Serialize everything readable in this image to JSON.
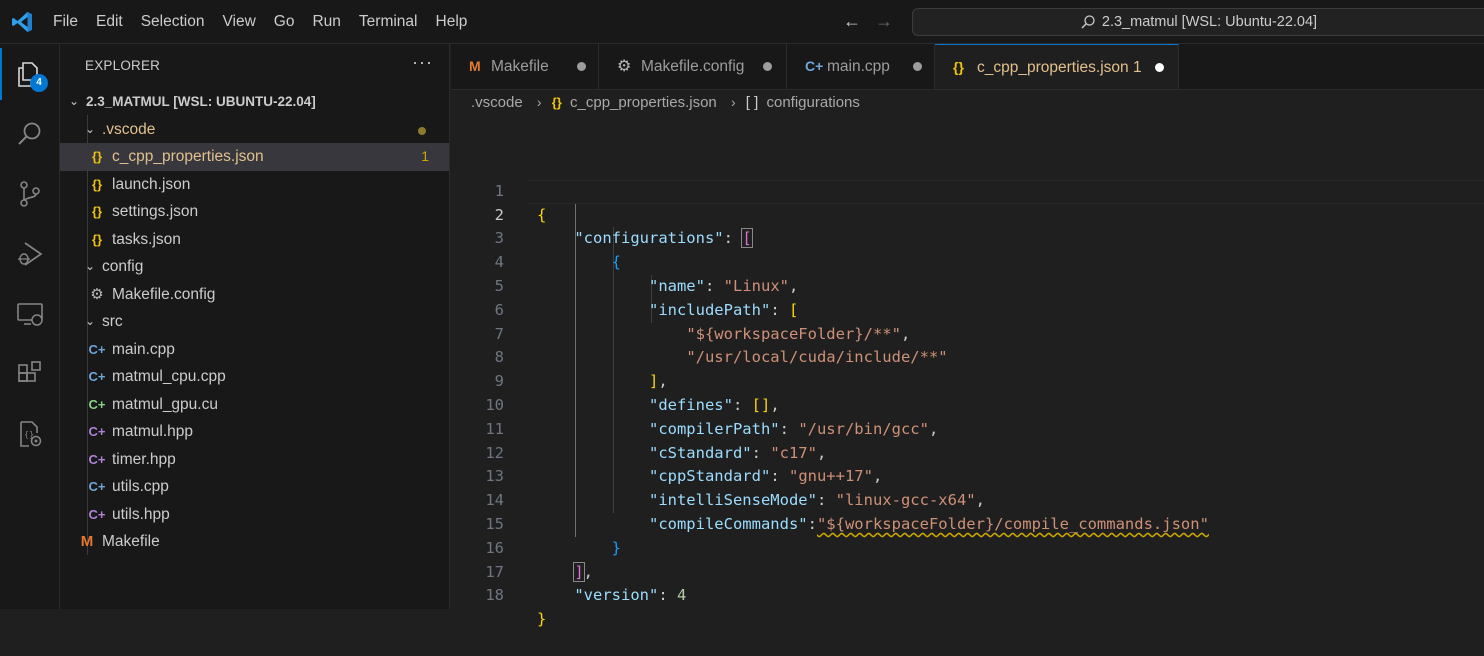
{
  "titlebar": {
    "menu": [
      "File",
      "Edit",
      "Selection",
      "View",
      "Go",
      "Run",
      "Terminal",
      "Help"
    ],
    "command_center": "2.3_matmul [WSL: Ubuntu-22.04]"
  },
  "activitybar": {
    "items": [
      "explorer-icon",
      "search-icon",
      "source-control-icon",
      "run-debug-icon",
      "remote-explorer-icon",
      "extensions-icon",
      "cmake-icon"
    ],
    "explorer_badge": "4"
  },
  "sidebar": {
    "header": "EXPLORER",
    "more": "···",
    "root": "2.3_MATMUL [WSL: UBUNTU-22.04]",
    "tree": [
      {
        "label": ".vscode",
        "type": "folder",
        "modified": true
      },
      {
        "label": "c_cpp_properties.json",
        "icon": "{}",
        "count": "1",
        "selected": true
      },
      {
        "label": "launch.json",
        "icon": "{}"
      },
      {
        "label": "settings.json",
        "icon": "{}"
      },
      {
        "label": "tasks.json",
        "icon": "{}"
      },
      {
        "label": "config",
        "type": "folder"
      },
      {
        "label": "Makefile.config",
        "icon": "gear-icon"
      },
      {
        "label": "src",
        "type": "folder"
      },
      {
        "label": "main.cpp",
        "icon": "C+"
      },
      {
        "label": "matmul_cpu.cpp",
        "icon": "C+"
      },
      {
        "label": "matmul_gpu.cu",
        "icon": "C+"
      },
      {
        "label": "matmul.hpp",
        "icon": "C+"
      },
      {
        "label": "timer.hpp",
        "icon": "C+"
      },
      {
        "label": "utils.cpp",
        "icon": "C+"
      },
      {
        "label": "utils.hpp",
        "icon": "C+"
      },
      {
        "label": "Makefile",
        "icon": "M"
      }
    ]
  },
  "tabs": [
    {
      "label": "Makefile",
      "icon": "M"
    },
    {
      "label": "Makefile.config",
      "icon": "gear-icon"
    },
    {
      "label": "main.cpp",
      "icon": "C+"
    },
    {
      "label": "c_cpp_properties.json 1",
      "icon": "{}",
      "active": true
    }
  ],
  "breadcrumb": {
    "folder": ".vscode",
    "file_icon": "{}",
    "file": "c_cpp_properties.json",
    "symbol_icon": "[ ]",
    "symbol": "configurations"
  },
  "editor": {
    "line_numbers": [
      "1",
      "2",
      "3",
      "4",
      "5",
      "6",
      "7",
      "8",
      "9",
      "10",
      "11",
      "12",
      "13",
      "14",
      "15",
      "16",
      "17",
      "18"
    ],
    "current_line": "2",
    "lines": {
      "l1_open": "{",
      "l2_key": "\"configurations\"",
      "l2_colon": ": ",
      "l2_br": "[",
      "l3_br": "{",
      "l4_key": "\"name\"",
      "l4_val": "\"Linux\"",
      "l5_key": "\"includePath\"",
      "l5_br": "[",
      "l6_val": "\"${workspaceFolder}/**\"",
      "l7_val": "\"/usr/local/cuda/include/**\"",
      "l8_br": "]",
      "l9_key": "\"defines\"",
      "l9_val": "[]",
      "l10_key": "\"compilerPath\"",
      "l10_val": "\"/usr/bin/gcc\"",
      "l11_key": "\"cStandard\"",
      "l11_val": "\"c17\"",
      "l12_key": "\"cppStandard\"",
      "l12_val": "\"gnu++17\"",
      "l13_key": "\"intelliSenseMode\"",
      "l13_val": "\"linux-gcc-x64\"",
      "l14_key": "\"compileCommands\"",
      "l14_val": "\"${workspaceFolder}/compile_commands.json\"",
      "l15_br": "}",
      "l16_br": "]",
      "l17_key": "\"version\"",
      "l17_val": "4",
      "l18_close": "}"
    }
  },
  "colors": {
    "accent": "#0078d4",
    "json_key": "#9cdcfe",
    "json_string": "#ce9178",
    "json_number": "#b5cea8",
    "modified": "#e2c08d"
  }
}
